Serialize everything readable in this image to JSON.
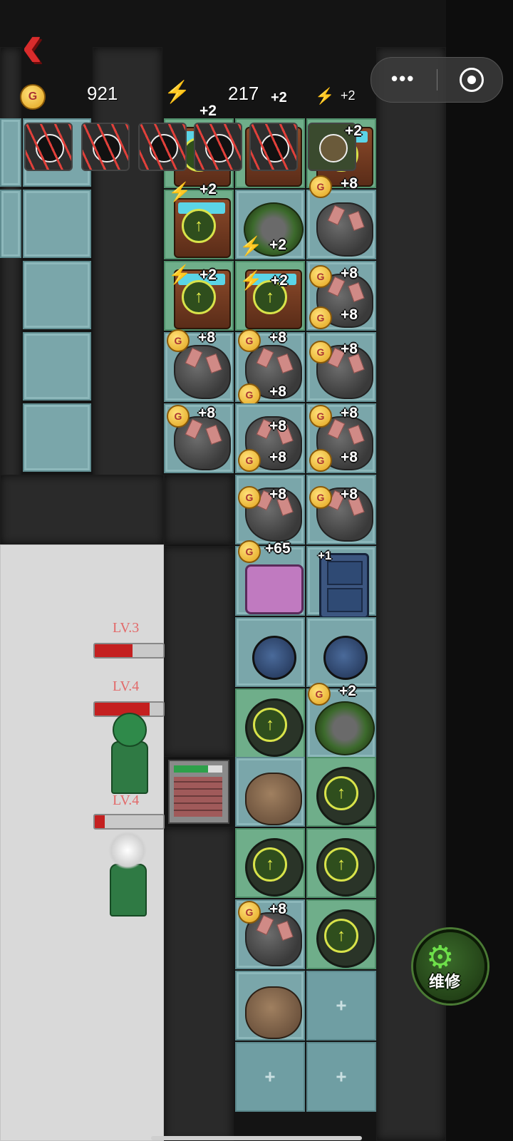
{
  "header": {
    "gold": "921",
    "energy": "217",
    "energy_rate": "+2",
    "energy_rate_2": "+2"
  },
  "grid_badges": {
    "plus2": "+2",
    "plus8": "+8",
    "plus65": "+65",
    "plus1": "+1"
  },
  "units": [
    {
      "level": "LV.3",
      "hp": 0.55
    },
    {
      "level": "LV.4",
      "hp": 0.8
    },
    {
      "level": "LV.4",
      "hp": 0.15
    }
  ],
  "shelf_progress": 0.7,
  "repair": {
    "label": "维修"
  },
  "colors": {
    "accent_red": "#d92c2c",
    "gold": "#e2a21c",
    "energy": "#5fc6e6",
    "upgrade": "#d8e34a",
    "repair_green": "#6ee04a"
  },
  "icons": {
    "back": "chevron-left-icon",
    "more": "more-dots-icon",
    "target": "target-icon",
    "coin": "gold-coin-icon",
    "bolt": "lightning-icon",
    "upgrade": "upgrade-arrow-icon",
    "repair": "wrench-gear-icon"
  }
}
